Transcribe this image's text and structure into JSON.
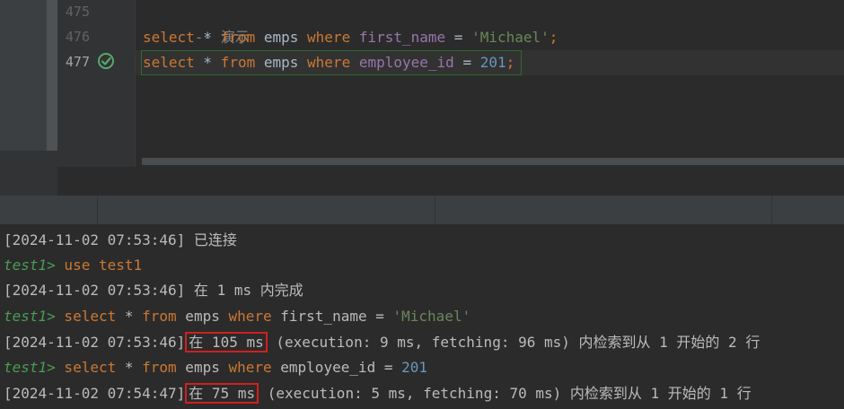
{
  "editor": {
    "lines": [
      {
        "num": "475",
        "comment": "-- 演示"
      },
      {
        "num": "476",
        "kw1": "select",
        "star": " * ",
        "kw2": "from",
        "table": " emps ",
        "kw3": "where",
        "sp": " ",
        "col": "first_name",
        "op": " = ",
        "val": "'Michael'",
        "end": ";"
      },
      {
        "num": "477",
        "kw1": "select",
        "star": " * ",
        "kw2": "from",
        "table": " emps ",
        "kw3": "where",
        "sp": " ",
        "col": "employee_id",
        "op": " = ",
        "val": "201",
        "end": ";"
      }
    ],
    "status_icon": "check-circle-icon"
  },
  "console": {
    "lines": [
      {
        "ts": "[2024-11-02 07:53:46]",
        "msg": " 已连接"
      },
      {
        "prompt": "test1>",
        "sql": " use test1"
      },
      {
        "ts": "[2024-11-02 07:53:46]",
        "msg": " 在 1 ms 内完成"
      },
      {
        "prompt": "test1>",
        "kw1": " select",
        "star": " * ",
        "kw2": "from",
        "table": " emps ",
        "kw3": "where",
        "col": " first_name",
        "op": " = ",
        "val": "'Michael'"
      },
      {
        "ts": "[2024-11-02 07:53:46]",
        "time": "在 105 ms",
        "rest": " (execution: 9 ms, fetching: 96 ms) 内检索到从 1 开始的 2 行"
      },
      {
        "prompt": "test1>",
        "kw1": " select",
        "star": " * ",
        "kw2": "from",
        "table": " emps ",
        "kw3": "where",
        "col": " employee_id",
        "op": " = ",
        "val": "201"
      },
      {
        "ts": "[2024-11-02 07:54:47]",
        "time": "在 75 ms",
        "rest": " (execution: 5 ms, fetching: 70 ms) 内检索到从 1 开始的 1 行"
      }
    ]
  },
  "colors": {
    "keyword": "#cc7832",
    "column": "#9876aa",
    "string": "#6a8759",
    "number": "#6897bb",
    "prompt": "#499c54",
    "highlight": "#d21f1f"
  }
}
